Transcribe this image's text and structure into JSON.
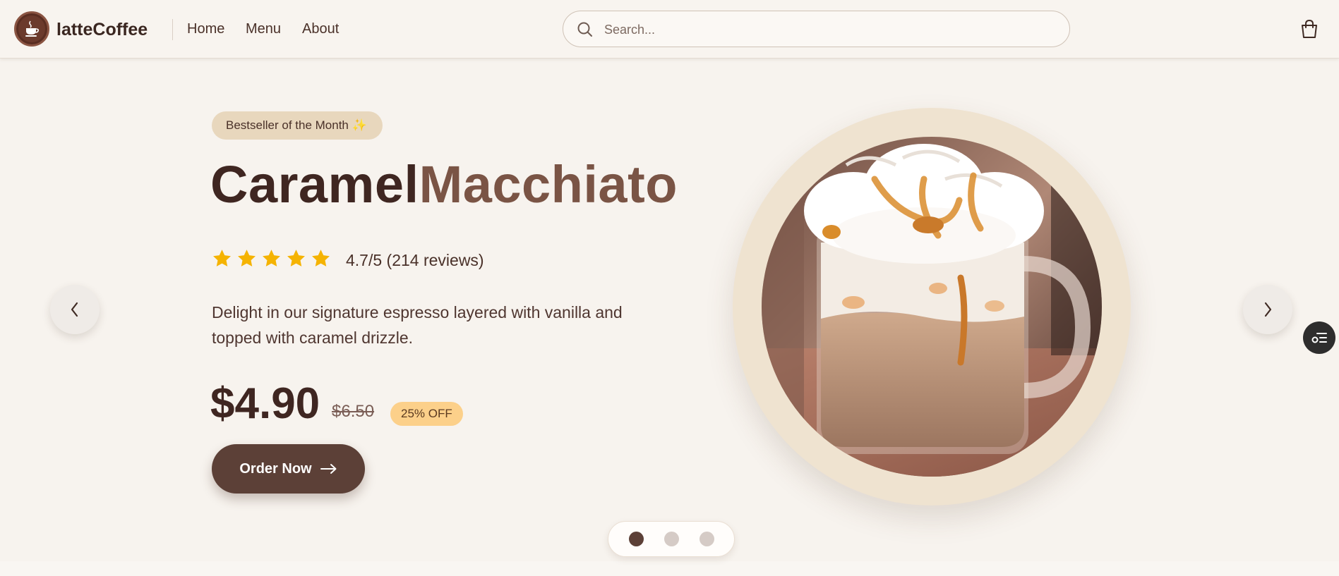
{
  "header": {
    "brand": "latteCoffee",
    "nav": [
      {
        "label": "Home"
      },
      {
        "label": "Menu"
      },
      {
        "label": "About"
      }
    ],
    "search": {
      "placeholder": "Search...",
      "value": ""
    },
    "icons": {
      "logo": "coffee-cup-icon",
      "search": "search-icon",
      "cart": "shopping-bag-icon"
    }
  },
  "hero": {
    "badge": "Bestseller of the Month ✨",
    "title_part1": "Caramel",
    "title_part2": "Macchiato",
    "rating": {
      "stars": 5,
      "text": "4.7/5 (214 reviews)"
    },
    "description": "Delight in our signature espresso layered with vanilla and topped with caramel drizzle.",
    "price": "$4.90",
    "old_price": "$6.50",
    "discount": "25% OFF",
    "order_button": "Order Now",
    "carousel": {
      "total": 3,
      "active_index": 0
    }
  },
  "colors": {
    "background": "#f7f3ee",
    "primary_brown": "#5c4037",
    "title_dark": "#3f2621",
    "title_light": "#7a5445",
    "star": "#f5b301",
    "badge_bg": "#e8d7bd",
    "discount_bg": "#fcd08a"
  }
}
